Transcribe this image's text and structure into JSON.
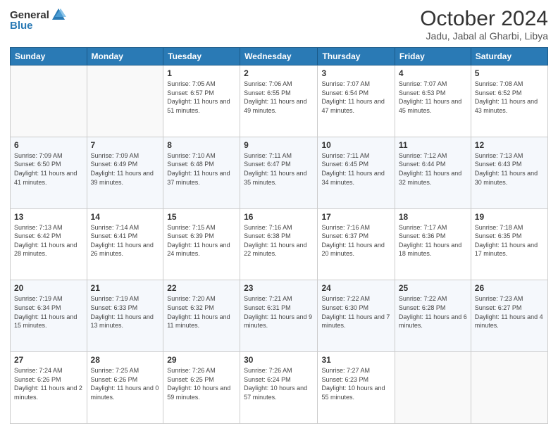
{
  "logo": {
    "general": "General",
    "blue": "Blue"
  },
  "title": {
    "month": "October 2024",
    "location": "Jadu, Jabal al Gharbi, Libya"
  },
  "weekdays": [
    "Sunday",
    "Monday",
    "Tuesday",
    "Wednesday",
    "Thursday",
    "Friday",
    "Saturday"
  ],
  "weeks": [
    [
      {
        "day": "",
        "sunrise": "",
        "sunset": "",
        "daylight": ""
      },
      {
        "day": "",
        "sunrise": "",
        "sunset": "",
        "daylight": ""
      },
      {
        "day": "1",
        "sunrise": "Sunrise: 7:05 AM",
        "sunset": "Sunset: 6:57 PM",
        "daylight": "Daylight: 11 hours and 51 minutes."
      },
      {
        "day": "2",
        "sunrise": "Sunrise: 7:06 AM",
        "sunset": "Sunset: 6:55 PM",
        "daylight": "Daylight: 11 hours and 49 minutes."
      },
      {
        "day": "3",
        "sunrise": "Sunrise: 7:07 AM",
        "sunset": "Sunset: 6:54 PM",
        "daylight": "Daylight: 11 hours and 47 minutes."
      },
      {
        "day": "4",
        "sunrise": "Sunrise: 7:07 AM",
        "sunset": "Sunset: 6:53 PM",
        "daylight": "Daylight: 11 hours and 45 minutes."
      },
      {
        "day": "5",
        "sunrise": "Sunrise: 7:08 AM",
        "sunset": "Sunset: 6:52 PM",
        "daylight": "Daylight: 11 hours and 43 minutes."
      }
    ],
    [
      {
        "day": "6",
        "sunrise": "Sunrise: 7:09 AM",
        "sunset": "Sunset: 6:50 PM",
        "daylight": "Daylight: 11 hours and 41 minutes."
      },
      {
        "day": "7",
        "sunrise": "Sunrise: 7:09 AM",
        "sunset": "Sunset: 6:49 PM",
        "daylight": "Daylight: 11 hours and 39 minutes."
      },
      {
        "day": "8",
        "sunrise": "Sunrise: 7:10 AM",
        "sunset": "Sunset: 6:48 PM",
        "daylight": "Daylight: 11 hours and 37 minutes."
      },
      {
        "day": "9",
        "sunrise": "Sunrise: 7:11 AM",
        "sunset": "Sunset: 6:47 PM",
        "daylight": "Daylight: 11 hours and 35 minutes."
      },
      {
        "day": "10",
        "sunrise": "Sunrise: 7:11 AM",
        "sunset": "Sunset: 6:45 PM",
        "daylight": "Daylight: 11 hours and 34 minutes."
      },
      {
        "day": "11",
        "sunrise": "Sunrise: 7:12 AM",
        "sunset": "Sunset: 6:44 PM",
        "daylight": "Daylight: 11 hours and 32 minutes."
      },
      {
        "day": "12",
        "sunrise": "Sunrise: 7:13 AM",
        "sunset": "Sunset: 6:43 PM",
        "daylight": "Daylight: 11 hours and 30 minutes."
      }
    ],
    [
      {
        "day": "13",
        "sunrise": "Sunrise: 7:13 AM",
        "sunset": "Sunset: 6:42 PM",
        "daylight": "Daylight: 11 hours and 28 minutes."
      },
      {
        "day": "14",
        "sunrise": "Sunrise: 7:14 AM",
        "sunset": "Sunset: 6:41 PM",
        "daylight": "Daylight: 11 hours and 26 minutes."
      },
      {
        "day": "15",
        "sunrise": "Sunrise: 7:15 AM",
        "sunset": "Sunset: 6:39 PM",
        "daylight": "Daylight: 11 hours and 24 minutes."
      },
      {
        "day": "16",
        "sunrise": "Sunrise: 7:16 AM",
        "sunset": "Sunset: 6:38 PM",
        "daylight": "Daylight: 11 hours and 22 minutes."
      },
      {
        "day": "17",
        "sunrise": "Sunrise: 7:16 AM",
        "sunset": "Sunset: 6:37 PM",
        "daylight": "Daylight: 11 hours and 20 minutes."
      },
      {
        "day": "18",
        "sunrise": "Sunrise: 7:17 AM",
        "sunset": "Sunset: 6:36 PM",
        "daylight": "Daylight: 11 hours and 18 minutes."
      },
      {
        "day": "19",
        "sunrise": "Sunrise: 7:18 AM",
        "sunset": "Sunset: 6:35 PM",
        "daylight": "Daylight: 11 hours and 17 minutes."
      }
    ],
    [
      {
        "day": "20",
        "sunrise": "Sunrise: 7:19 AM",
        "sunset": "Sunset: 6:34 PM",
        "daylight": "Daylight: 11 hours and 15 minutes."
      },
      {
        "day": "21",
        "sunrise": "Sunrise: 7:19 AM",
        "sunset": "Sunset: 6:33 PM",
        "daylight": "Daylight: 11 hours and 13 minutes."
      },
      {
        "day": "22",
        "sunrise": "Sunrise: 7:20 AM",
        "sunset": "Sunset: 6:32 PM",
        "daylight": "Daylight: 11 hours and 11 minutes."
      },
      {
        "day": "23",
        "sunrise": "Sunrise: 7:21 AM",
        "sunset": "Sunset: 6:31 PM",
        "daylight": "Daylight: 11 hours and 9 minutes."
      },
      {
        "day": "24",
        "sunrise": "Sunrise: 7:22 AM",
        "sunset": "Sunset: 6:30 PM",
        "daylight": "Daylight: 11 hours and 7 minutes."
      },
      {
        "day": "25",
        "sunrise": "Sunrise: 7:22 AM",
        "sunset": "Sunset: 6:28 PM",
        "daylight": "Daylight: 11 hours and 6 minutes."
      },
      {
        "day": "26",
        "sunrise": "Sunrise: 7:23 AM",
        "sunset": "Sunset: 6:27 PM",
        "daylight": "Daylight: 11 hours and 4 minutes."
      }
    ],
    [
      {
        "day": "27",
        "sunrise": "Sunrise: 7:24 AM",
        "sunset": "Sunset: 6:26 PM",
        "daylight": "Daylight: 11 hours and 2 minutes."
      },
      {
        "day": "28",
        "sunrise": "Sunrise: 7:25 AM",
        "sunset": "Sunset: 6:26 PM",
        "daylight": "Daylight: 11 hours and 0 minutes."
      },
      {
        "day": "29",
        "sunrise": "Sunrise: 7:26 AM",
        "sunset": "Sunset: 6:25 PM",
        "daylight": "Daylight: 10 hours and 59 minutes."
      },
      {
        "day": "30",
        "sunrise": "Sunrise: 7:26 AM",
        "sunset": "Sunset: 6:24 PM",
        "daylight": "Daylight: 10 hours and 57 minutes."
      },
      {
        "day": "31",
        "sunrise": "Sunrise: 7:27 AM",
        "sunset": "Sunset: 6:23 PM",
        "daylight": "Daylight: 10 hours and 55 minutes."
      },
      {
        "day": "",
        "sunrise": "",
        "sunset": "",
        "daylight": ""
      },
      {
        "day": "",
        "sunrise": "",
        "sunset": "",
        "daylight": ""
      }
    ]
  ]
}
